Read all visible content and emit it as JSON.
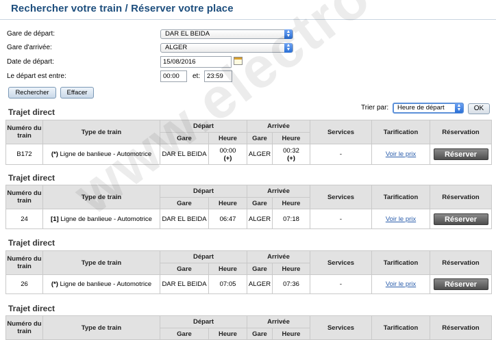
{
  "page": {
    "title": "Rechercher votre train / Réserver votre place"
  },
  "form": {
    "depart_label": "Gare de départ:",
    "depart_value": "DAR EL BEIDA",
    "arrivee_label": "Gare d'arrivée:",
    "arrivee_value": "ALGER",
    "date_label": "Date de départ:",
    "date_value": "15/08/2016",
    "time_label": "Le départ est entre:",
    "time_from": "00:00",
    "time_and_label": "et:",
    "time_to": "23:59",
    "search_button": "Rechercher",
    "clear_button": "Effacer"
  },
  "sort": {
    "label": "Trier par:",
    "value": "Heure de départ",
    "ok_button": "OK"
  },
  "table_headers": {
    "numero": "Numéro du train",
    "type": "Type de train",
    "depart": "Départ",
    "arrivee": "Arrivée",
    "gare": "Gare",
    "heure": "Heure",
    "services": "Services",
    "tarification": "Tarification",
    "reservation": "Réservation"
  },
  "sections": [
    {
      "title": "Trajet direct",
      "train": {
        "numero": "B172",
        "type_prefix": "(*)",
        "type": "Ligne de banlieue - Automotrice",
        "depart_gare": "DAR EL BEIDA",
        "depart_heure": "00:00",
        "depart_note": "(+)",
        "arrivee_gare": "ALGER",
        "arrivee_heure": "00:32",
        "arrivee_note": "(+)",
        "services": "-",
        "price_link": "Voir le prix",
        "reserve_button": "Réserver"
      }
    },
    {
      "title": "Trajet direct",
      "train": {
        "numero": "24",
        "type_prefix": "[1]",
        "type": "Ligne de banlieue - Automotrice",
        "depart_gare": "DAR EL BEIDA",
        "depart_heure": "06:47",
        "depart_note": "",
        "arrivee_gare": "ALGER",
        "arrivee_heure": "07:18",
        "arrivee_note": "",
        "services": "-",
        "price_link": "Voir le prix",
        "reserve_button": "Réserver"
      }
    },
    {
      "title": "Trajet direct",
      "train": {
        "numero": "26",
        "type_prefix": "(*)",
        "type": "Ligne de banlieue - Automotrice",
        "depart_gare": "DAR EL BEIDA",
        "depart_heure": "07:05",
        "depart_note": "",
        "arrivee_gare": "ALGER",
        "arrivee_heure": "07:36",
        "arrivee_note": "",
        "services": "-",
        "price_link": "Voir le prix",
        "reserve_button": "Réserver"
      }
    },
    {
      "title": "Trajet direct"
    }
  ],
  "watermark": "www.electrodz.com",
  "icons": {
    "select_arrow": "chevron-updown-icon",
    "calendar": "calendar-icon"
  },
  "colors": {
    "title": "#1d4e7d",
    "header_bg": "#e2e2e2",
    "link": "#2a5dab",
    "reserve_button": "#5a5a5a"
  }
}
